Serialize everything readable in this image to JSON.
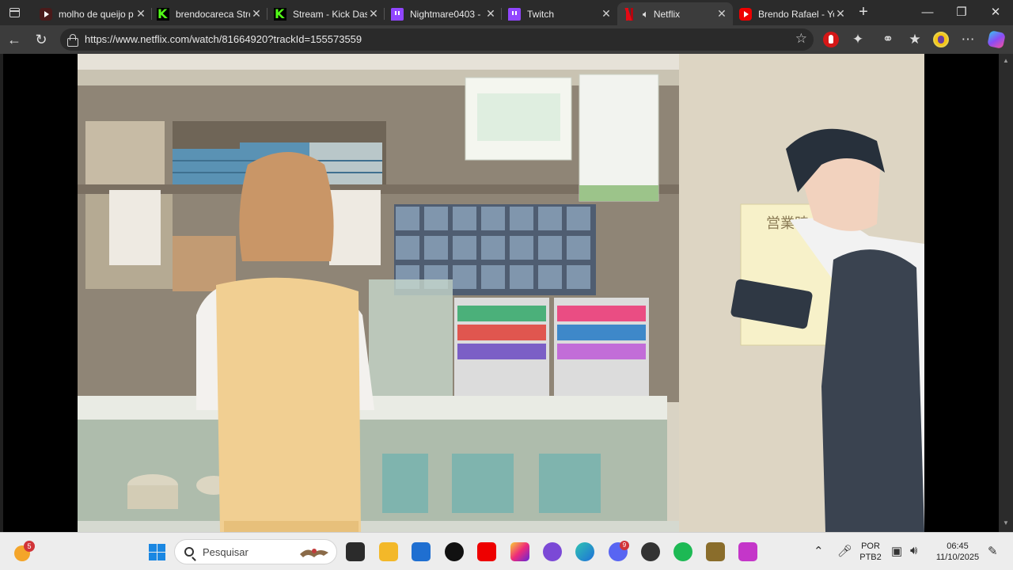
{
  "browser": {
    "tabs": [
      {
        "title": "molho de queijo p",
        "favicon": "youtube-icon",
        "active": false
      },
      {
        "title": "brendocareca Stre",
        "favicon": "kick-icon",
        "active": false
      },
      {
        "title": "Stream - Kick Dasl",
        "favicon": "kick-icon",
        "active": false
      },
      {
        "title": "Nightmare0403 -",
        "favicon": "twitch-icon",
        "active": false
      },
      {
        "title": "Twitch",
        "favicon": "twitch-icon",
        "active": false
      },
      {
        "title": "Netflix",
        "favicon": "netflix-icon",
        "active": true,
        "audio": true
      },
      {
        "title": "Brendo Rafael - Yo",
        "favicon": "youtube-icon",
        "active": false
      }
    ],
    "close_glyph": "✕",
    "new_tab_glyph": "+",
    "address": {
      "url": "https://www.netflix.com/watch/81664920?trackId=155573559"
    }
  },
  "taskbar": {
    "widget_badge": "5",
    "search_placeholder": "Pesquisar",
    "discord_badge": "9",
    "language_line1": "POR",
    "language_line2": "PTB2",
    "time": "06:45",
    "date": "11/10/2025"
  },
  "video": {
    "scene_sign_text": "営業時"
  },
  "colors": {
    "tab_strip": "#2b2b2b",
    "active_tab": "#3c3c3c",
    "taskbar": "#ededed",
    "netflix_red": "#e50914"
  }
}
